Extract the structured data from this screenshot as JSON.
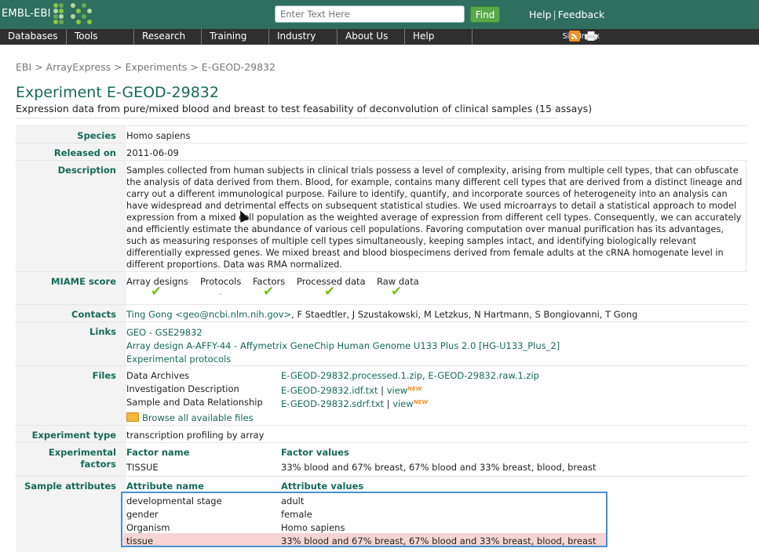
{
  "header": {
    "logo_text": "EMBL-EBI",
    "search_placeholder": "Enter Text Here",
    "find_label": "Find",
    "help_label": "Help",
    "feedback_label": "Feedback",
    "brand_color": "#2e6f60"
  },
  "nav": {
    "items": [
      "Databases",
      "Tools",
      "Research",
      "Training",
      "Industry",
      "About Us",
      "Help"
    ],
    "site_index": "Site Index"
  },
  "breadcrumb": {
    "ebi": "EBI",
    "arrayexpress": "ArrayExpress",
    "experiments": "Experiments",
    "current": "E-GEOD-29832",
    "separator": ">"
  },
  "experiment": {
    "title": "Experiment E-GEOD-29832",
    "subtitle": "Expression data from pure/mixed blood and breast to test feasability of deconvolution of clinical samples (15 assays)"
  },
  "labels": {
    "species": "Species",
    "released": "Released on",
    "description": "Description",
    "miame": "MIAME score",
    "contacts": "Contacts",
    "links": "Links",
    "files": "Files",
    "exp_type": "Experiment type",
    "exp_factors_1": "Experimental",
    "exp_factors_2": "factors",
    "sample_attrs": "Sample attributes"
  },
  "values": {
    "species": "Homo sapiens",
    "released": "2011-06-09",
    "description": "Samples collected from human subjects in clinical trials possess a level of complexity, arising from multiple cell types, that can obfuscate the analysis of data derived from them. Blood, for example, contains many different cell types that are derived from a distinct lineage and carry out a different immunological purpose. Failure to identify, quantify, and incorporate sources of heterogeneity into an analysis can have widespread and detrimental effects on subsequent statistical studies. We used microarrays to detail a statistical approach to model expression from a mixed cell population as the weighted average of expression from different cell types. Consequently, we can accurately and efficiently estimate the abundance of various cell populations. Favoring computation over manual purification has its advantages, such as measuring responses of multiple cell types simultaneously, keeping samples intact, and identifying biologically relevant differentially expressed genes. We mixed breast and blood biospecimens derived from female adults at the cRNA homogenate level in different proportions. Data was RMA normalized.",
    "exp_type": "transcription profiling by array"
  },
  "miame": {
    "headers": [
      "Array designs",
      "Protocols",
      "Factors",
      "Processed data",
      "Raw data"
    ],
    "dash": "-"
  },
  "contacts": {
    "primary": "Ting Gong <geo@ncbi.nlm.nih.gov>",
    "others": ", F Staedtler, J Szustakowski, M Letzkus, N Hartmann, S Bongiovanni, T Gong"
  },
  "links": {
    "geo": "GEO - GSE29832",
    "array_design": "Array design A-AFFY-44 - Affymetrix GeneChip Human Genome U133 Plus 2.0 [HG-U133_Plus_2]",
    "protocols": "Experimental protocols"
  },
  "files": {
    "archives_label": "Data Archives",
    "archive_processed": "E-GEOD-29832.processed.1.zip",
    "archive_comma": ",",
    "archive_raw": "E-GEOD-29832.raw.1.zip",
    "idf_label": "Investigation Description",
    "idf_file": "E-GEOD-29832.idf.txt",
    "sdrf_label": "Sample and Data Relationship",
    "sdrf_file": "E-GEOD-29832.sdrf.txt",
    "view": "view",
    "pipe": "|",
    "new_badge": "NEW",
    "browse_all": "Browse all available files"
  },
  "factors": {
    "name_header": "Factor name",
    "values_header": "Factor values",
    "name": "TISSUE",
    "values": "33% blood and 67% breast, 67% blood and 33% breast, blood, breast"
  },
  "sample_attributes": {
    "name_header": "Attribute name",
    "values_header": "Attribute values",
    "rows": [
      {
        "name": "developmental stage",
        "value": "adult"
      },
      {
        "name": "gender",
        "value": "female"
      },
      {
        "name": "Organism",
        "value": "Homo sapiens"
      },
      {
        "name": "tissue",
        "value": "33% blood and 67% breast, 67% blood and 33% breast, blood, breast"
      }
    ]
  }
}
